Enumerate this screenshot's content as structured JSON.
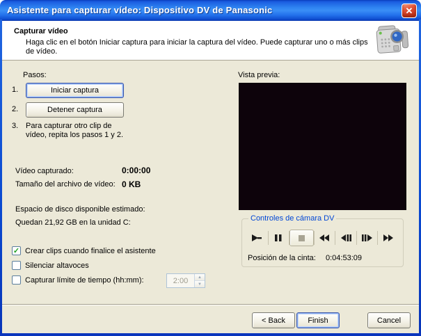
{
  "window": {
    "title": "Asistente para capturar vídeo: Dispositivo DV de Panasonic"
  },
  "icons": {
    "close": "✕",
    "spinner_up": "▲",
    "spinner_down": "▼"
  },
  "header": {
    "title": "Capturar vídeo",
    "description": "Haga clic en el botón Iniciar captura para iniciar la captura del vídeo. Puede capturar uno o más clips de vídeo."
  },
  "steps": {
    "label": "Pasos:",
    "step1_number": "1.",
    "start_button": "Iniciar captura",
    "step2_number": "2.",
    "stop_button": "Detener captura",
    "step3_number": "3.",
    "step3_text": "Para capturar otro clip de vídeo, repita los pasos 1 y 2."
  },
  "stats": {
    "captured_label": "Vídeo capturado:",
    "captured_value": "0:00:00",
    "size_label": "Tamaño del archivo de vídeo:",
    "size_value": "0 KB",
    "disk_line1": "Espacio de disco disponible estimado:",
    "disk_line2": "Quedan 21,92 GB en la unidad C:"
  },
  "options": {
    "checkboxes": [
      {
        "label": "Crear clips cuando finalice el asistente",
        "checked": true,
        "mark": "✓"
      },
      {
        "label": "Silenciar altavoces",
        "checked": false,
        "mark": ""
      },
      {
        "label": "Capturar límite de tiempo (hh:mm):",
        "checked": false,
        "mark": ""
      }
    ],
    "time_limit_value": "2:00"
  },
  "preview": {
    "label": "Vista previa:"
  },
  "dv_controls": {
    "legend": "Controles de cámara DV",
    "buttons": [
      "play",
      "pause",
      "stop",
      "rewind",
      "previous-frame",
      "next-frame",
      "fast-forward"
    ],
    "position_label": "Posición de la cinta:",
    "position_value": "0:04:53:09"
  },
  "footer": {
    "back_label": "< Back",
    "finish_label": "Finish",
    "cancel_label": "Cancel"
  },
  "colors": {
    "titlebar_blue": "#2372ec",
    "dialog_bg": "#ece9d8",
    "legend_blue": "#0046d5",
    "close_red": "#cc3a22",
    "check_green": "#21a121",
    "preview_black": "#0d030b"
  }
}
